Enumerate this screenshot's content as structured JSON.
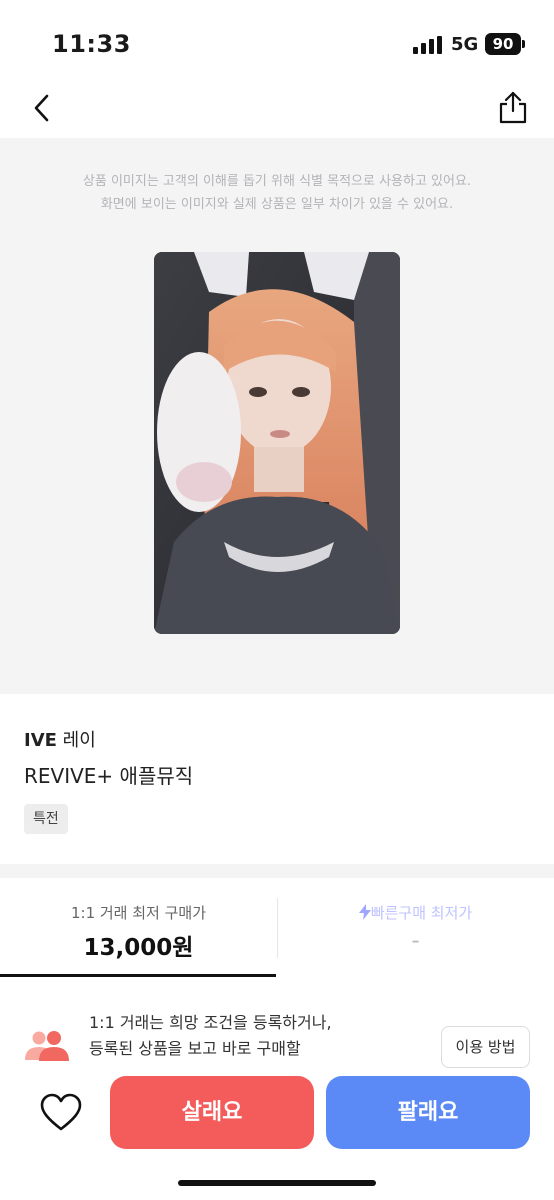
{
  "status_bar": {
    "time": "11:33",
    "network": "5G",
    "battery": "90"
  },
  "nav": {
    "back_icon": "chevron-left-icon",
    "share_icon": "share-icon"
  },
  "image_section": {
    "notice_line1": "상품 이미지는 고객의 이해를 돕기 위해 식별 목적으로 사용하고 있어요.",
    "notice_line2": "화면에 보이는 이미지와 실제 상품은 일부 차이가 있을 수 있어요."
  },
  "product": {
    "artist": "IVE",
    "member": "레이",
    "name": "REVIVE+ 애플뮤직",
    "tag": "특전"
  },
  "price_tabs": [
    {
      "label": "1:1 거래 최저 구매가",
      "value": "13,000원",
      "active": true
    },
    {
      "label": "빠른구매 최저가",
      "value": "-",
      "active": false,
      "icon": "lightning-icon"
    }
  ],
  "info": {
    "icon": "people-icon",
    "line1": "1:1 거래는 희망 조건을 등록하거나,",
    "line2": "등록된 상품을 보고 바로 구매할",
    "usage_button": "이용 방법"
  },
  "actions": {
    "like_icon": "heart-icon",
    "buy_label": "살래요",
    "sell_label": "팔래요",
    "buy_color": "#f45b5b",
    "sell_color": "#5b8af7"
  }
}
